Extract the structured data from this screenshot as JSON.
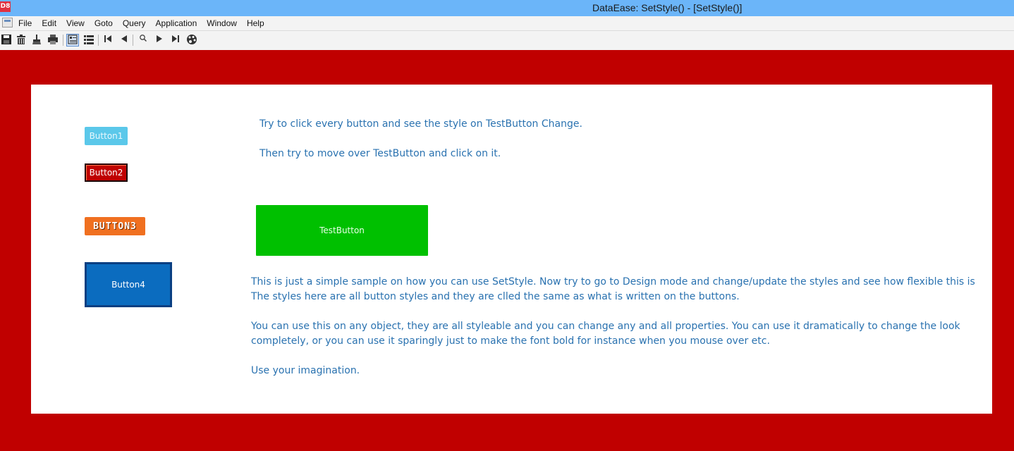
{
  "window": {
    "app_icon_text": "D8",
    "title": "DataEase: SetStyle() - [SetStyle()]"
  },
  "menu": {
    "items": [
      "File",
      "Edit",
      "View",
      "Goto",
      "Query",
      "Application",
      "Window",
      "Help"
    ]
  },
  "toolbar": {
    "icons": [
      "save-icon",
      "delete-icon",
      "clear-icon",
      "print-icon",
      "form-view-icon",
      "table-view-icon",
      "first-record-icon",
      "previous-record-icon",
      "search-icon",
      "next-record-icon",
      "last-record-icon",
      "palette-icon"
    ]
  },
  "colors": {
    "title_bar": "#6bb5f9",
    "background": "#c00000",
    "panel": "#ffffff",
    "text": "#2a72b0",
    "button1": "#5bc8ea",
    "button2": "#c00000",
    "button3": "#f07020",
    "button4": "#0b6cbf",
    "test_button": "#00c000"
  },
  "form": {
    "buttons": {
      "button1": "Button1",
      "button2": "Button2",
      "button3": "BUTTON3",
      "button4": "Button4",
      "test_button": "TestButton"
    },
    "instructions": {
      "line1": "Try to click every button and see the style on TestButton Change.",
      "line2": "Then try to move over TestButton and click on it."
    },
    "description": {
      "line1": "This is just a simple sample on how you can use SetStyle. Now try to go to Design mode and change/update the styles and see how flexible this is",
      "line2": "The styles here are all button styles and they are clled the same as what is written on the buttons.",
      "line3": "You can use this on any object, they are all styleable and you can change any and all properties. You can use it dramatically to change the look",
      "line4": "completely, or you can use it sparingly just to make the font bold for instance when  you mouse over etc.",
      "line5": "Use your imagination."
    }
  }
}
